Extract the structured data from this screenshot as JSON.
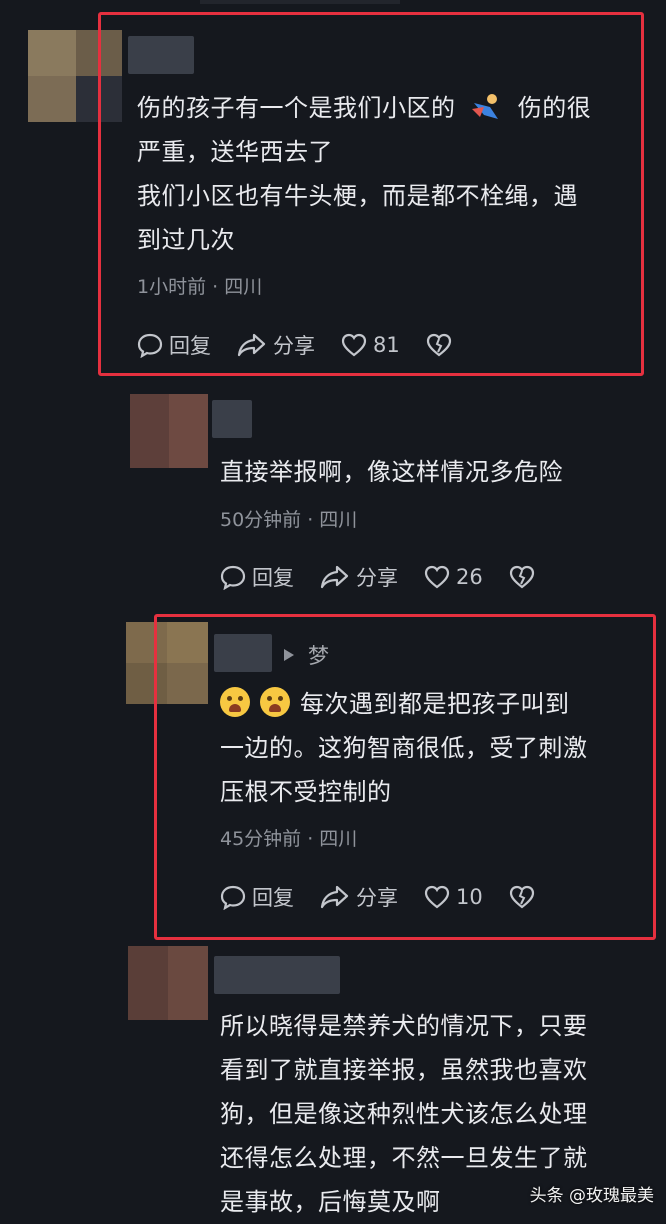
{
  "comments": [
    {
      "lines": [
        "伤的孩子有一个是我们小区的",
        "伤的很",
        "严重，送华西去了",
        "我们小区也有牛头梗，而是都不栓绳，遇",
        "到过几次"
      ],
      "emoji_icon": "running-child-icon",
      "meta": "1小时前 · 四川",
      "reply_label": "回复",
      "share_label": "分享",
      "likes": "81"
    },
    {
      "lines": [
        "直接举报啊，像这样情况多危险"
      ],
      "meta": "50分钟前 · 四川",
      "reply_label": "回复",
      "share_label": "分享",
      "likes": "26"
    },
    {
      "reply_to": "梦",
      "emoji_icon": "crying-face-icon",
      "lines": [
        "每次遇到都是把孩子叫到",
        "一边的。这狗智商很低，受了刺激",
        "压根不受控制的"
      ],
      "meta": "45分钟前 · 四川",
      "reply_label": "回复",
      "share_label": "分享",
      "likes": "10"
    },
    {
      "lines": [
        "所以晓得是禁养犬的情况下，只要",
        "看到了就直接举报，虽然我也喜欢",
        "狗，但是像这种烈性犬该怎么处理",
        "还得怎么处理，不然一旦发生了就",
        "是事故，后悔莫及啊"
      ]
    }
  ],
  "watermark": "头条 @玫瑰最美",
  "colors": {
    "highlight": "#e5303f",
    "background": "#15181e"
  }
}
